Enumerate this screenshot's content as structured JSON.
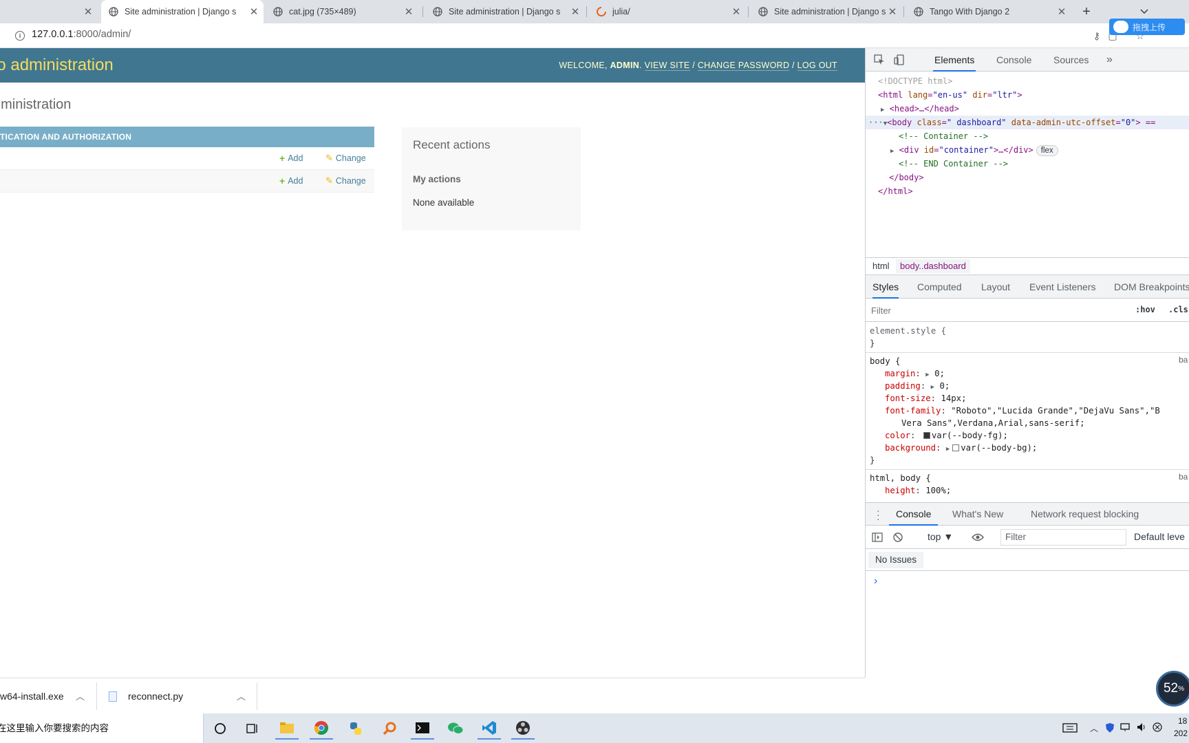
{
  "browser": {
    "tabs": [
      {
        "title": "",
        "active": false
      },
      {
        "title": "Site administration | Django s",
        "active": true
      },
      {
        "title": "cat.jpg (735×489)",
        "active": false
      },
      {
        "title": "Site administration | Django s",
        "active": false
      },
      {
        "title": "julia/",
        "active": false
      },
      {
        "title": "Site administration | Django s",
        "active": false
      },
      {
        "title": "Tango With Django 2",
        "active": false
      }
    ],
    "new_tab_label": "+",
    "url_host": "127.0.0.1",
    "url_rest": ":8000/admin/",
    "extension_badge": "拖拽上传"
  },
  "django": {
    "branding": "go administration",
    "usertools": {
      "welcome": "WELCOME, ",
      "user": "ADMIN",
      "sep1": ". ",
      "view_site": "VIEW SITE",
      "slash1": " / ",
      "change_password": "CHANGE PASSWORD",
      "slash2": " / ",
      "log_out": "LOG OUT"
    },
    "page_title": "dministration",
    "module_caption": "TICATION AND AUTHORIZATION",
    "rows": [
      {
        "add": "Add",
        "change": "Change"
      },
      {
        "add": "Add",
        "change": "Change"
      }
    ],
    "recent": {
      "title": "Recent actions",
      "subtitle": "My actions",
      "empty": "None available"
    }
  },
  "devtools": {
    "tabs": {
      "elements": "Elements",
      "console": "Console",
      "sources": "Sources",
      "more": "»"
    },
    "dom": {
      "doctype": "<!DOCTYPE html>",
      "html_open_tag": "<html ",
      "html_lang_attr": "lang",
      "html_lang_val": "\"en-us\"",
      "html_dir_attr": "dir",
      "html_dir_val": "\"ltr\"",
      "html_close_bracket": ">",
      "head": "<head>…</head>",
      "body_tag": "<body ",
      "body_class_attr": "class",
      "body_class_val": "\" dashboard\"",
      "body_data_attr": "data-admin-utc-offset",
      "body_data_val": "\"0\"",
      "body_tail": "> ==",
      "comment1": "<!-- Container -->",
      "div_open": "<div ",
      "div_id_attr": "id",
      "div_id_val": "\"container\"",
      "div_tail": ">…</div>",
      "flex_badge": "flex",
      "comment2": "<!-- END Container -->",
      "body_close": "</body>",
      "html_close": "</html>",
      "ellipsis": "···"
    },
    "breadcrumbs": [
      "html",
      "body..dashboard"
    ],
    "style_tabs": [
      "Styles",
      "Computed",
      "Layout",
      "Event Listeners",
      "DOM Breakpoints"
    ],
    "filter_placeholder": "Filter",
    "hov": ":hov",
    "cls": ".cls",
    "rules": {
      "element_style": "element.style {",
      "close": "}",
      "body_selector": "body {",
      "margin_p": "margin",
      "margin_v": "0;",
      "padding_p": "padding",
      "padding_v": "0;",
      "fontsize_p": "font-size",
      "fontsize_v": "14px;",
      "fontfamily_p": "font-family",
      "fontfamily_v1": "\"Roboto\",\"Lucida Grande\",\"DejaVu Sans\",\"B",
      "fontfamily_v2": "Vera Sans\",Verdana,Arial,sans-serif;",
      "color_p": "color",
      "color_v": "var(--body-fg);",
      "bg_p": "background",
      "bg_v": "var(--body-bg);",
      "src1": "ba",
      "html_body_selector": "html, body {",
      "height_p": "height",
      "height_v": "100%;",
      "src2": "ba"
    },
    "drawer_tabs": [
      "Console",
      "What's New",
      "Network request blocking"
    ],
    "context": "top ▼",
    "console_filter": "Filter",
    "default_levels": "Default leve",
    "no_issues": "No Issues",
    "prompt": "›",
    "perf_badge": "52",
    "perf_unit": "%"
  },
  "downloads": [
    {
      "name": "w64-install.exe"
    },
    {
      "name": "reconnect.py"
    }
  ],
  "taskbar": {
    "search_placeholder": "在这里输入你要搜索的内容",
    "clock_time": "18",
    "clock_date": "202"
  },
  "colors": {
    "django_header": "#417690",
    "django_branding": "#f5dd5d",
    "module_caption": "#79aec8",
    "add_green": "#70bf2b",
    "change_yellow": "#efb80b",
    "link_blue": "#447e9b"
  }
}
